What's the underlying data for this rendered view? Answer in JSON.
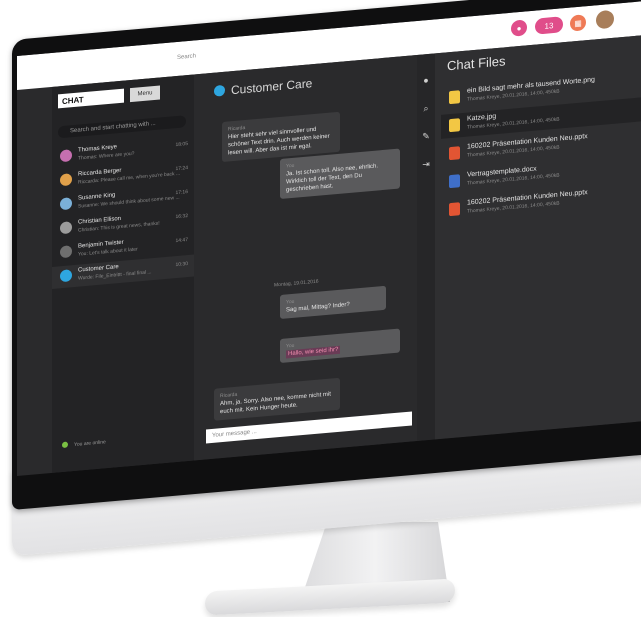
{
  "header": {
    "notification_count": "13",
    "badge_counts": [
      "",
      "13",
      ""
    ]
  },
  "left": {
    "logo_text": "CHAT",
    "menu_label": "Menu",
    "search_placeholder": "Search and start chatting with ...",
    "conversations": [
      {
        "name": "Thomas Kreye",
        "preview": "Thomas: Where are you?",
        "time": "18:05",
        "color": "#c66fb0"
      },
      {
        "name": "Riccarda Berger",
        "preview": "Riccarda: Please call me, when you're back ...",
        "time": "17:24",
        "color": "#e0a04a"
      },
      {
        "name": "Susanne King",
        "preview": "Susanne: We should think about some new ...",
        "time": "17:16",
        "color": "#7bb0d8"
      },
      {
        "name": "Christian Ellison",
        "preview": "Christian: This is great news, thanks!",
        "time": "16:32",
        "color": "#9c9c9c"
      },
      {
        "name": "Benjamin Twister",
        "preview": "You: Let's talk about it later",
        "time": "14:47",
        "color": "#6f6f6f"
      },
      {
        "name": "Customer Care",
        "preview": "Wurde: File_Eintrittt - final final ...",
        "time": "10:30",
        "color": "#2ea6e0"
      }
    ],
    "online_status": "You are online"
  },
  "center": {
    "global_search_placeholder": "Search",
    "title": "Customer Care",
    "date_separator": "Montag, 19.01.2016",
    "input_placeholder": "Your message ...",
    "messages": [
      {
        "who": "Ricarda",
        "text": "Hier steht sehr viel sinnvoller und schöner Text drin. Auch werden keiner lesen will. Aber das ist mir egal."
      },
      {
        "who": "You",
        "text": "Ja. Ist schon toll. Also nee, ehrlich. Wirklich toll der Text, den Du geschrieben hast."
      },
      {
        "who": "You",
        "text": "Sag mal, Mittag? Inder?"
      },
      {
        "who": "You",
        "text": "Hallo, wie seid ihr?"
      },
      {
        "who": "Ricarda",
        "text": "Ahm, ja. Sorry. Also nee, komme nicht mit euch mit. Kein Hunger heute."
      }
    ]
  },
  "files": {
    "title": "Chat Files",
    "items": [
      {
        "name": "ein Bild sagt mehr als tausend Worte.png",
        "meta": "Thomas Kreye, 20.01.2016, 14:00, 450kB",
        "color": "#f2c744"
      },
      {
        "name": "Katze.jpg",
        "meta": "Thomas Kreye, 20.01.2016, 14:00, 450kB",
        "color": "#f2c744"
      },
      {
        "name": "160202 Präsentation Kunden Neu.pptx",
        "meta": "Thomas Kreye, 20.01.2016, 14:00, 450kB",
        "color": "#e25533"
      },
      {
        "name": "Vertragstemplate.docx",
        "meta": "Thomas Kreye, 20.01.2016, 14:00, 450kB",
        "color": "#3f6fc9"
      },
      {
        "name": "160202 Präsentation Kunden Neu.pptx",
        "meta": "Thomas Kreye, 20.01.2016, 14:00, 450kB",
        "color": "#e25533"
      }
    ]
  }
}
